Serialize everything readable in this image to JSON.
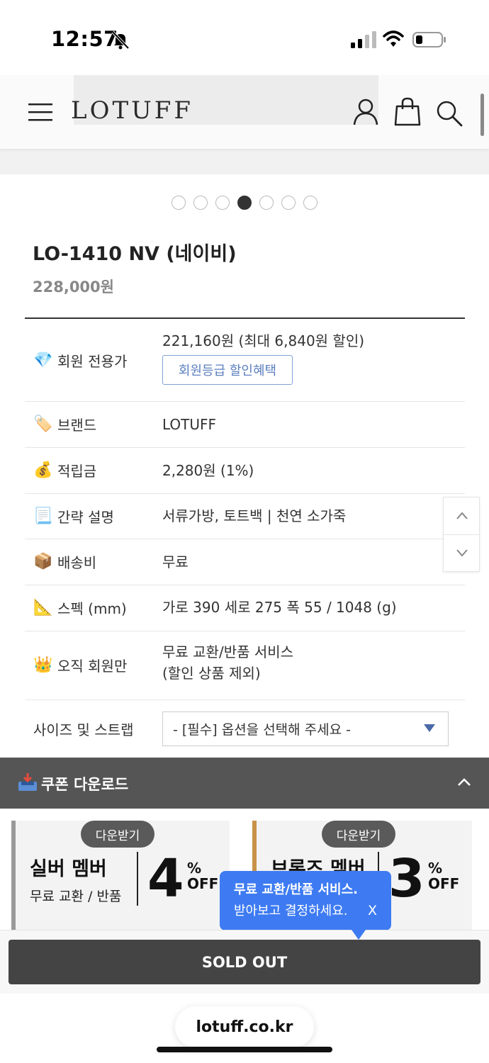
{
  "status_bar": {
    "time": "12:57"
  },
  "header": {
    "logo": "LOTUFF"
  },
  "carousel": {
    "total": 7,
    "active_index": 3
  },
  "product": {
    "name": "LO-1410 NV (네이비)",
    "price": "228,000원"
  },
  "info_rows": [
    {
      "icon": "💎",
      "label": "회원 전용가",
      "value": "221,160원 (최대 6,840원 할인)",
      "button": "회원등급 할인혜택"
    },
    {
      "icon": "🏷️",
      "label": "브랜드",
      "value": "LOTUFF"
    },
    {
      "icon": "💰",
      "label": "적립금",
      "value": "2,280원 (1%)"
    },
    {
      "icon": "📃",
      "label": "간략 설명",
      "value": "서류가방, 토트백 | 천연 소가죽"
    },
    {
      "icon": "📦",
      "label": "배송비",
      "value": "무료"
    },
    {
      "icon": "📐",
      "label": "스펙 (mm)",
      "value": "가로 390 세로 275 폭 55 / 1048 (g)"
    },
    {
      "icon": "👑",
      "label": "오직 회원만",
      "value_line1": "무료 교환/반품 서비스",
      "value_line2": "(할인 상품 제외)"
    }
  ],
  "option": {
    "label": "사이즈 및 스트랩",
    "selected": "- [필수] 옵션을 선택해 주세요 -"
  },
  "coupon": {
    "title": "쿠폰 다운로드",
    "cards": [
      {
        "badge": "다운받기",
        "name": "실버 멤버",
        "sub": "무료 교환 / 반품",
        "percent": "4",
        "pct_sign": "%",
        "off": "OFF",
        "stripe_color": "#999999"
      },
      {
        "badge": "다운받기",
        "name": "브론즈 멤버",
        "sub": "",
        "percent": "3",
        "pct_sign": "%",
        "off": "OFF",
        "stripe_color": "#c8924a"
      }
    ]
  },
  "tooltip": {
    "line1": "무료 교환/반품 서비스.",
    "line2": "받아보고 결정하세요.",
    "close": "X"
  },
  "buy": {
    "sold_out_label": "SOLD OUT"
  },
  "browser": {
    "url": "lotuff.co.kr"
  },
  "colors": {
    "tooltip": "#3e7bf2",
    "coupon_bar": "#555555",
    "sold_out": "#444444",
    "grade_button": "#5b7fbf"
  }
}
